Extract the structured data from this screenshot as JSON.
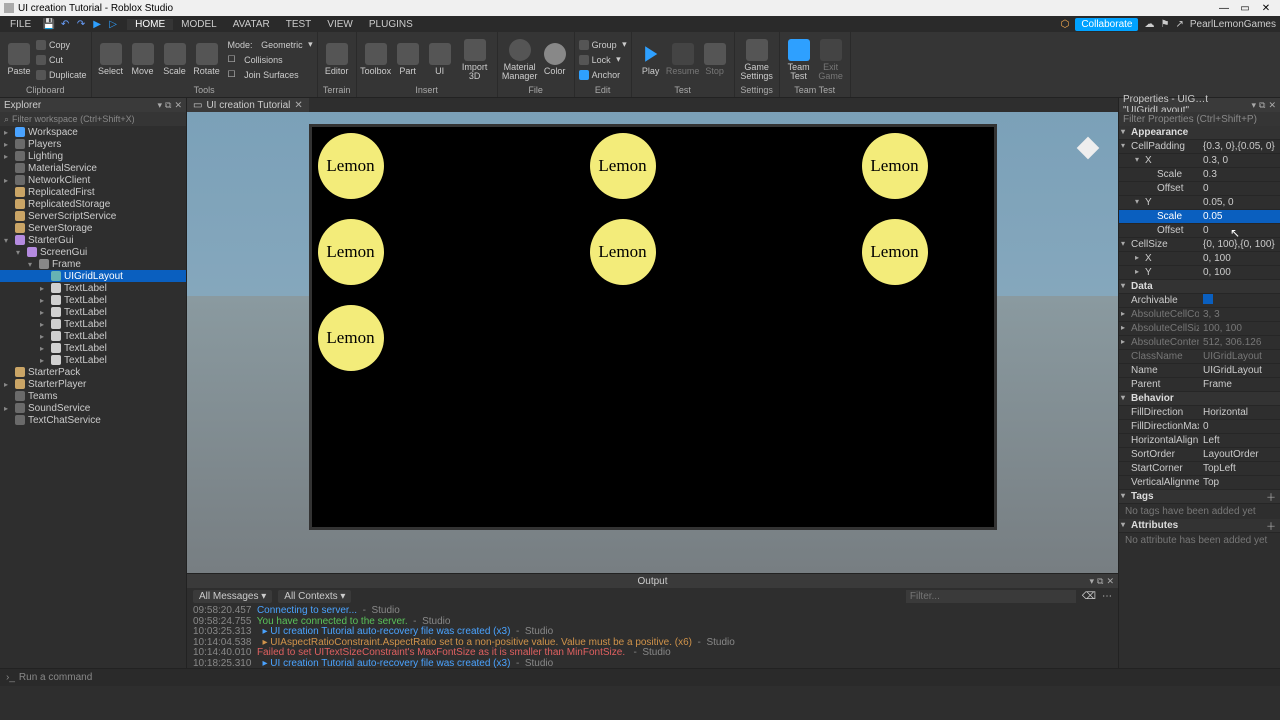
{
  "title": "UI creation Tutorial - Roblox Studio",
  "menus": [
    "FILE"
  ],
  "tabs": [
    "HOME",
    "MODEL",
    "AVATAR",
    "TEST",
    "VIEW",
    "PLUGINS"
  ],
  "active_tab": "HOME",
  "collaborate": "Collaborate",
  "username": "PearlLemonGames",
  "ribbon": {
    "clipboard": {
      "paste": "Paste",
      "copy": "Copy",
      "cut": "Cut",
      "dup": "Duplicate",
      "label": "Clipboard"
    },
    "tools": {
      "select": "Select",
      "move": "Move",
      "scale": "Scale",
      "rotate": "Rotate",
      "label": "Tools",
      "mode": "Mode:",
      "mode_v": "Geometric",
      "coll": "Collisions",
      "join": "Join Surfaces"
    },
    "terrain": {
      "editor": "Editor",
      "label": "Terrain"
    },
    "insert": {
      "toolbox": "Toolbox",
      "part": "Part",
      "ui": "UI",
      "import": "Import 3D",
      "label": "Insert"
    },
    "file": {
      "mm": "Material Manager",
      "color": "Color",
      "label": "File"
    },
    "edit": {
      "group": "Group",
      "lock": "Lock",
      "anchor": "Anchor",
      "label": "Edit"
    },
    "test": {
      "play": "Play",
      "resume": "Resume",
      "stop": "Stop",
      "label": "Test"
    },
    "settings": {
      "gs": "Game Settings",
      "label": "Settings"
    },
    "teamtest": {
      "tt": "Team Test",
      "exit": "Exit Game",
      "label": "Team Test"
    }
  },
  "explorer": {
    "title": "Explorer",
    "filter": "Filter workspace (Ctrl+Shift+X)",
    "nodes": [
      {
        "n": "Workspace",
        "i": "ic-ws",
        "d": 0,
        "a": "▸"
      },
      {
        "n": "Players",
        "i": "ic-svc",
        "d": 0,
        "a": "▸"
      },
      {
        "n": "Lighting",
        "i": "ic-svc",
        "d": 0,
        "a": "▸"
      },
      {
        "n": "MaterialService",
        "i": "ic-svc",
        "d": 0,
        "a": ""
      },
      {
        "n": "NetworkClient",
        "i": "ic-svc",
        "d": 0,
        "a": "▸"
      },
      {
        "n": "ReplicatedFirst",
        "i": "ic-folder",
        "d": 0,
        "a": ""
      },
      {
        "n": "ReplicatedStorage",
        "i": "ic-folder",
        "d": 0,
        "a": ""
      },
      {
        "n": "ServerScriptService",
        "i": "ic-folder",
        "d": 0,
        "a": ""
      },
      {
        "n": "ServerStorage",
        "i": "ic-folder",
        "d": 0,
        "a": ""
      },
      {
        "n": "StarterGui",
        "i": "ic-gui",
        "d": 0,
        "a": "▾"
      },
      {
        "n": "ScreenGui",
        "i": "ic-gui",
        "d": 1,
        "a": "▾"
      },
      {
        "n": "Frame",
        "i": "ic-frame",
        "d": 2,
        "a": "▾"
      },
      {
        "n": "UIGridLayout",
        "i": "ic-layout",
        "d": 3,
        "a": "",
        "sel": true
      },
      {
        "n": "TextLabel",
        "i": "ic-txt",
        "d": 3,
        "a": "▸"
      },
      {
        "n": "TextLabel",
        "i": "ic-txt",
        "d": 3,
        "a": "▸"
      },
      {
        "n": "TextLabel",
        "i": "ic-txt",
        "d": 3,
        "a": "▸"
      },
      {
        "n": "TextLabel",
        "i": "ic-txt",
        "d": 3,
        "a": "▸"
      },
      {
        "n": "TextLabel",
        "i": "ic-txt",
        "d": 3,
        "a": "▸"
      },
      {
        "n": "TextLabel",
        "i": "ic-txt",
        "d": 3,
        "a": "▸"
      },
      {
        "n": "TextLabel",
        "i": "ic-txt",
        "d": 3,
        "a": "▸"
      },
      {
        "n": "StarterPack",
        "i": "ic-folder",
        "d": 0,
        "a": ""
      },
      {
        "n": "StarterPlayer",
        "i": "ic-folder",
        "d": 0,
        "a": "▸"
      },
      {
        "n": "Teams",
        "i": "ic-svc",
        "d": 0,
        "a": ""
      },
      {
        "n": "SoundService",
        "i": "ic-svc",
        "d": 0,
        "a": "▸"
      },
      {
        "n": "TextChatService",
        "i": "ic-svc",
        "d": 0,
        "a": ""
      }
    ]
  },
  "doc_tab": "UI creation Tutorial",
  "lemon_text": "Lemon",
  "output": {
    "title": "Output",
    "dd1": "All Messages",
    "dd2": "All Contexts",
    "filter": "Filter...",
    "lines": [
      {
        "ts": "09:58:20.457",
        "cls": "c-inf",
        "msg": "Connecting to server...",
        "suf": "  -  Studio"
      },
      {
        "ts": "09:58:24.755",
        "cls": "c-ok",
        "msg": "You have connected to the server.",
        "suf": "  -  Studio"
      },
      {
        "ts": "10:03:25.313",
        "cls": "c-inf",
        "msg": "  ▸ UI creation Tutorial auto-recovery file was created (x3)",
        "suf": "  -  Studio"
      },
      {
        "ts": "10:14:04.538",
        "cls": "c-wr",
        "msg": "  ▸ UIAspectRatioConstraint.AspectRatio set to a non-positive value. Value must be a positive. (x6)",
        "suf": "  -  Studio"
      },
      {
        "ts": "10:14:40.010",
        "cls": "c-er",
        "msg": "Failed to set UITextSizeConstraint's MaxFontSize as it is smaller than MinFontSize.",
        "suf": "   -  Studio"
      },
      {
        "ts": "10:18:25.310",
        "cls": "c-inf",
        "msg": "  ▸ UI creation Tutorial auto-recovery file was created (x3)",
        "suf": "  -  Studio"
      }
    ]
  },
  "props": {
    "title": "Properties - UIG…t \"UIGridLayout\"",
    "filter": "Filter Properties (Ctrl+Shift+P)",
    "rows": [
      {
        "t": "sec",
        "k": "Appearance"
      },
      {
        "t": "row",
        "k": "CellPadding",
        "v": "{0.3, 0},{0.05, 0}",
        "sub": 0,
        "exp": "▾"
      },
      {
        "t": "row",
        "k": "X",
        "v": "0.3, 0",
        "sub": 1,
        "exp": "▾"
      },
      {
        "t": "row",
        "k": "Scale",
        "v": "0.3",
        "sub": 2
      },
      {
        "t": "row",
        "k": "Offset",
        "v": "0",
        "sub": 2
      },
      {
        "t": "row",
        "k": "Y",
        "v": "0.05, 0",
        "sub": 1,
        "exp": "▾"
      },
      {
        "t": "row",
        "k": "Scale",
        "v": "0.05",
        "sub": 2,
        "sel": true
      },
      {
        "t": "row",
        "k": "Offset",
        "v": "0",
        "sub": 2
      },
      {
        "t": "row",
        "k": "CellSize",
        "v": "{0, 100},{0, 100}",
        "sub": 0,
        "exp": "▾"
      },
      {
        "t": "row",
        "k": "X",
        "v": "0, 100",
        "sub": 1,
        "exp": "▸"
      },
      {
        "t": "row",
        "k": "Y",
        "v": "0, 100",
        "sub": 1,
        "exp": "▸"
      },
      {
        "t": "sec",
        "k": "Data"
      },
      {
        "t": "row",
        "k": "Archivable",
        "v": "[check]",
        "sub": 0
      },
      {
        "t": "ro",
        "k": "AbsoluteCellCo…",
        "v": "3, 3",
        "sub": 0,
        "exp": "▸"
      },
      {
        "t": "ro",
        "k": "AbsoluteCellSize",
        "v": "100, 100",
        "sub": 0,
        "exp": "▸"
      },
      {
        "t": "ro",
        "k": "AbsoluteConten…",
        "v": "512, 306.126",
        "sub": 0,
        "exp": "▸"
      },
      {
        "t": "ro",
        "k": "ClassName",
        "v": "UIGridLayout",
        "sub": 0
      },
      {
        "t": "row",
        "k": "Name",
        "v": "UIGridLayout",
        "sub": 0
      },
      {
        "t": "row",
        "k": "Parent",
        "v": "Frame",
        "sub": 0
      },
      {
        "t": "sec",
        "k": "Behavior"
      },
      {
        "t": "row",
        "k": "FillDirection",
        "v": "Horizontal",
        "sub": 0
      },
      {
        "t": "row",
        "k": "FillDirectionMax…",
        "v": "0",
        "sub": 0
      },
      {
        "t": "row",
        "k": "HorizontalAlign…",
        "v": "Left",
        "sub": 0
      },
      {
        "t": "row",
        "k": "SortOrder",
        "v": "LayoutOrder",
        "sub": 0
      },
      {
        "t": "row",
        "k": "StartCorner",
        "v": "TopLeft",
        "sub": 0
      },
      {
        "t": "row",
        "k": "VerticalAlignment",
        "v": "Top",
        "sub": 0
      },
      {
        "t": "sec",
        "k": "Tags",
        "add": true
      },
      {
        "t": "empty",
        "k": "No tags have been added yet"
      },
      {
        "t": "sec",
        "k": "Attributes",
        "add": true
      },
      {
        "t": "empty",
        "k": "No attribute has been added yet"
      }
    ]
  },
  "cmd_placeholder": "Run a command"
}
